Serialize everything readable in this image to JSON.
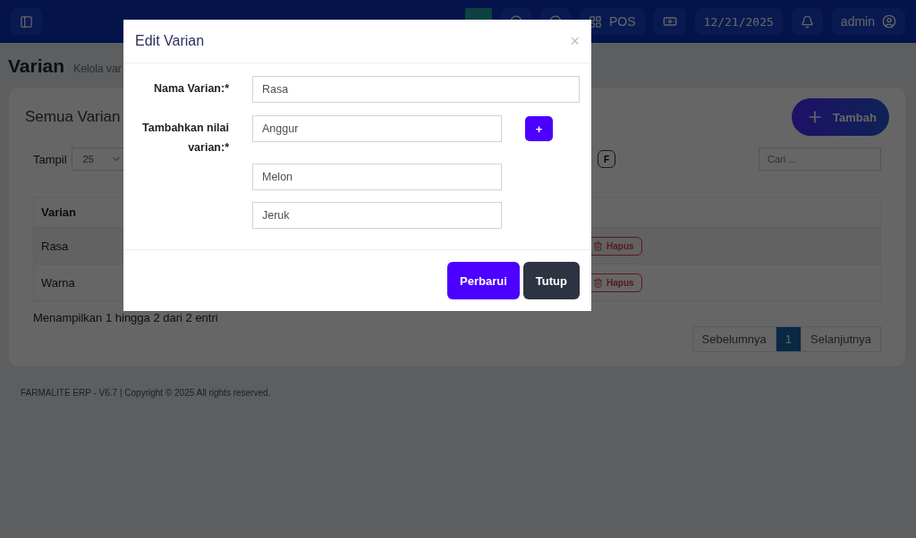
{
  "navbar": {
    "items": [
      {
        "kind": "toggle"
      },
      {
        "kind": "tile"
      },
      {
        "kind": "icon"
      },
      {
        "kind": "icon"
      },
      {
        "kind": "pos",
        "label": "POS"
      },
      {
        "kind": "camera"
      },
      {
        "kind": "date",
        "label": "12/21/2025"
      },
      {
        "kind": "bell"
      },
      {
        "kind": "user",
        "label": "admin"
      }
    ]
  },
  "page": {
    "title": "Varian",
    "subtitle": "Kelola var"
  },
  "card": {
    "title": "Semua Varian",
    "add_button": "Tambah",
    "show_label": "Tampil",
    "page_size": "25",
    "export_button": "F",
    "search": {
      "placeholder": "Cari ..."
    },
    "table": {
      "columns": [
        "Varian"
      ],
      "rows": [
        {
          "cells": [
            "Rasa"
          ],
          "action": "Hapus"
        },
        {
          "cells": [
            "Warna"
          ],
          "action": "Hapus"
        }
      ]
    },
    "info": "Menampilkan 1 hingga 2 dari 2 entri",
    "pagination": {
      "previous": "Sebelumnya",
      "pages": [
        {
          "label": "1",
          "selected": true
        }
      ],
      "next": "Selanjutnya"
    }
  },
  "footer": "FARMALITE ERP - V6.7 | Copyright © 2025 All rights reserved.",
  "modal": {
    "title": "Edit Varian",
    "close": "×",
    "name_label": "Nama Varian:*",
    "name_value": "Rasa",
    "values_label": "Tambahkan nilai varian:*",
    "values": [
      "Anggur",
      "Melon",
      "Jeruk"
    ],
    "add_value_button": "+",
    "buttons": [
      {
        "label": "Perbarui",
        "kind": "primary"
      },
      {
        "label": "Tutup",
        "kind": "dark"
      }
    ]
  }
}
